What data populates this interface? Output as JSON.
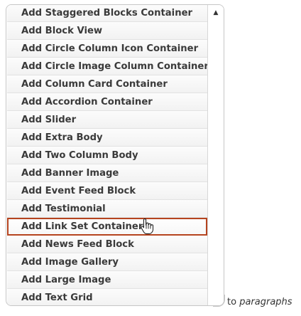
{
  "dropdown": {
    "items": [
      {
        "label": "Add Staggered Blocks Container"
      },
      {
        "label": "Add Block View"
      },
      {
        "label": "Add Circle Column Icon Container"
      },
      {
        "label": "Add Circle Image Column Container"
      },
      {
        "label": "Add Column Card Container"
      },
      {
        "label": "Add Accordion Container"
      },
      {
        "label": "Add Slider"
      },
      {
        "label": "Add Extra Body"
      },
      {
        "label": "Add Two Column Body"
      },
      {
        "label": "Add Banner Image"
      },
      {
        "label": "Add Event Feed Block"
      },
      {
        "label": "Add Testimonial"
      },
      {
        "label": "Add Link Set Container",
        "hovered": true
      },
      {
        "label": "Add News Feed Block"
      },
      {
        "label": "Add Image Gallery"
      },
      {
        "label": "Add Large Image"
      },
      {
        "label": "Add Text Grid"
      }
    ],
    "scroll_up_icon": "triangle-up-icon",
    "cursor_icon": "hand-pointer-icon"
  },
  "trailing_text": {
    "prefix": "to",
    "emphasis": "paragraphs"
  },
  "colors": {
    "hover_border": "#b5441f",
    "item_text": "#3a3a3a",
    "border": "#c6c6c6"
  }
}
